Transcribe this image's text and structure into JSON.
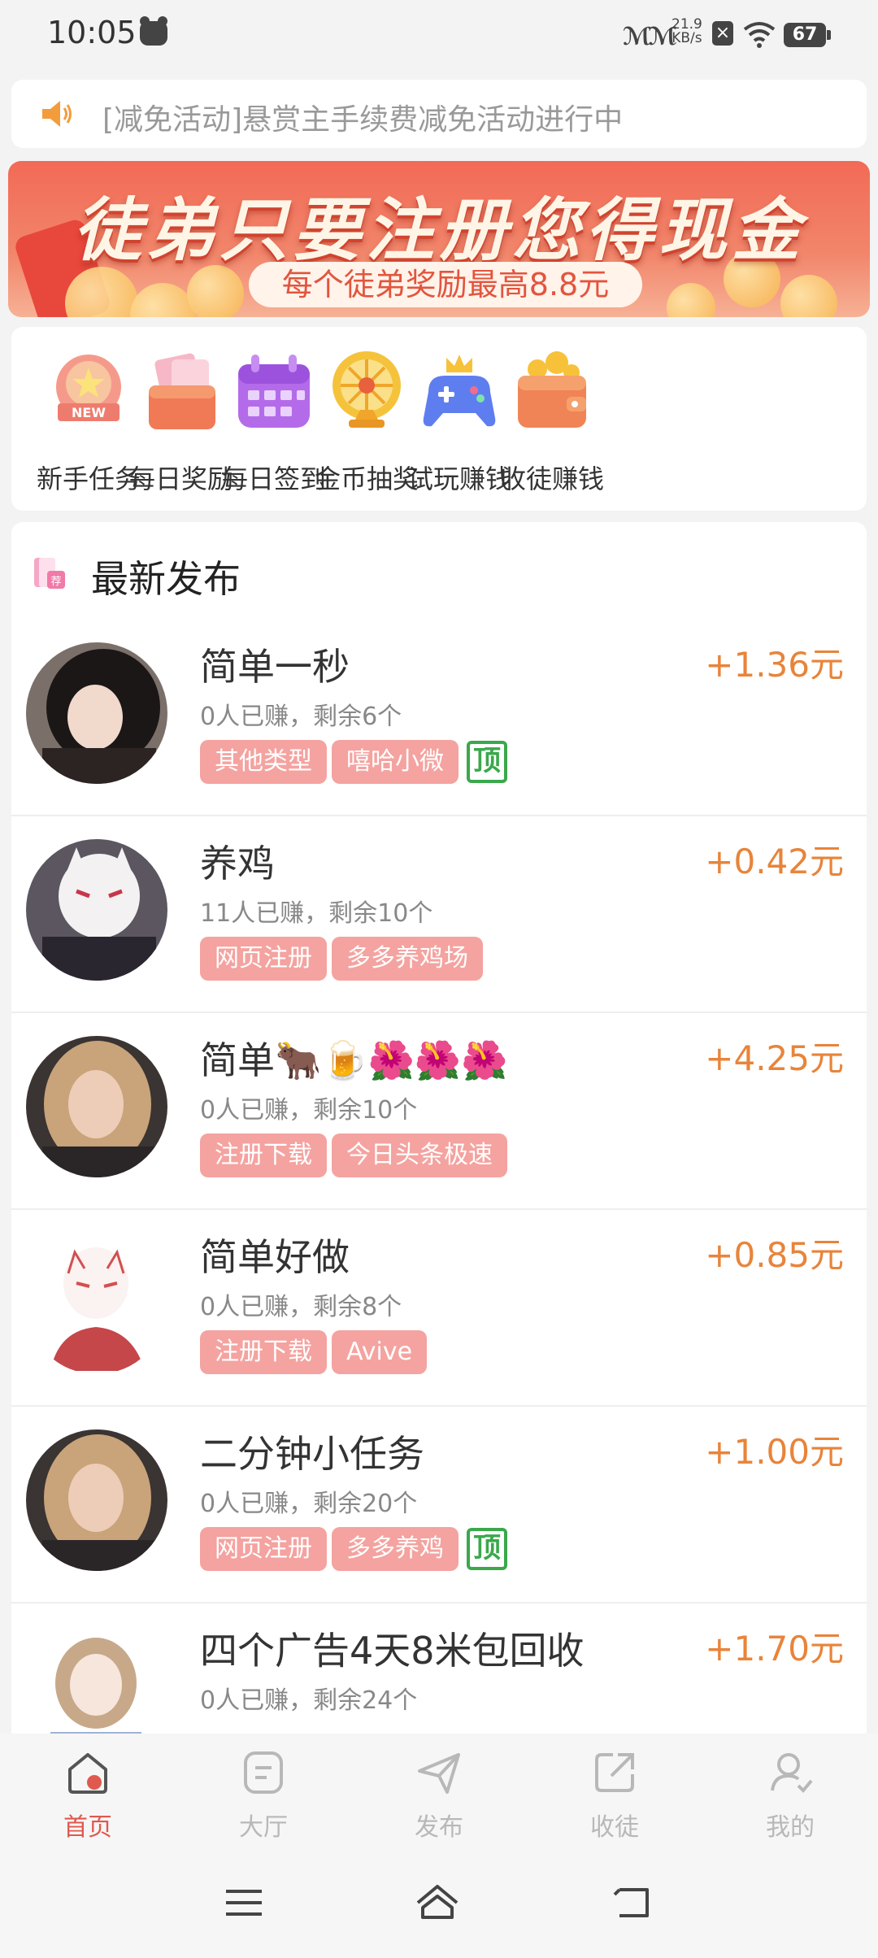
{
  "status_bar": {
    "time": "10:05",
    "net_speed_value": "21.9",
    "net_speed_unit": "KB/s",
    "battery": "67",
    "signal": "??"
  },
  "notice": {
    "icon": "speaker-icon",
    "text": "[减免活动]悬赏主手续费减免活动进行中"
  },
  "banner": {
    "title": "徒弟只要注册您得现金",
    "subtitle": "每个徒弟奖励最高8.8元"
  },
  "quick_menu": [
    {
      "label": "新手任务",
      "icon": "new-badge-icon"
    },
    {
      "label": "每日奖励",
      "icon": "red-envelope-icon"
    },
    {
      "label": "每日签到",
      "icon": "calendar-icon"
    },
    {
      "label": "金币抽奖",
      "icon": "wheel-icon"
    },
    {
      "label": "试玩赚钱",
      "icon": "gamepad-icon"
    },
    {
      "label": "收徒赚钱",
      "icon": "wallet-icon"
    }
  ],
  "latest": {
    "title": "最新发布",
    "items": [
      {
        "title": "简单一秒",
        "meta": "0人已赚，剩余6个",
        "price": "+1.36元",
        "tags": [
          "其他类型",
          "嘻哈小微"
        ],
        "top": "顶"
      },
      {
        "title": "养鸡",
        "meta": "11人已赚，剩余10个",
        "price": "+0.42元",
        "tags": [
          "网页注册",
          "多多养鸡场"
        ],
        "top": ""
      },
      {
        "title": "简单🐂🍺🌺🌺🌺",
        "meta": "0人已赚，剩余10个",
        "price": "+4.25元",
        "tags": [
          "注册下载",
          "今日头条极速"
        ],
        "top": ""
      },
      {
        "title": "简单好做",
        "meta": "0人已赚，剩余8个",
        "price": "+0.85元",
        "tags": [
          "注册下载",
          "Avive"
        ],
        "top": ""
      },
      {
        "title": "二分钟小任务",
        "meta": "0人已赚，剩余20个",
        "price": "+1.00元",
        "tags": [
          "网页注册",
          "多多养鸡"
        ],
        "top": "顶"
      },
      {
        "title": "四个广告4天8米包回收",
        "meta": "0人已赚，剩余24个",
        "price": "+1.70元",
        "tags": [],
        "top": ""
      }
    ]
  },
  "bottom_nav": [
    {
      "label": "首页",
      "active": true
    },
    {
      "label": "大厅",
      "active": false
    },
    {
      "label": "发布",
      "active": false
    },
    {
      "label": "收徒",
      "active": false
    },
    {
      "label": "我的",
      "active": false
    }
  ],
  "colors": {
    "accent": "#e0594e",
    "price": "#e8843a",
    "tag_bg": "#f4a3a0",
    "top_badge": "#3aa84b"
  }
}
